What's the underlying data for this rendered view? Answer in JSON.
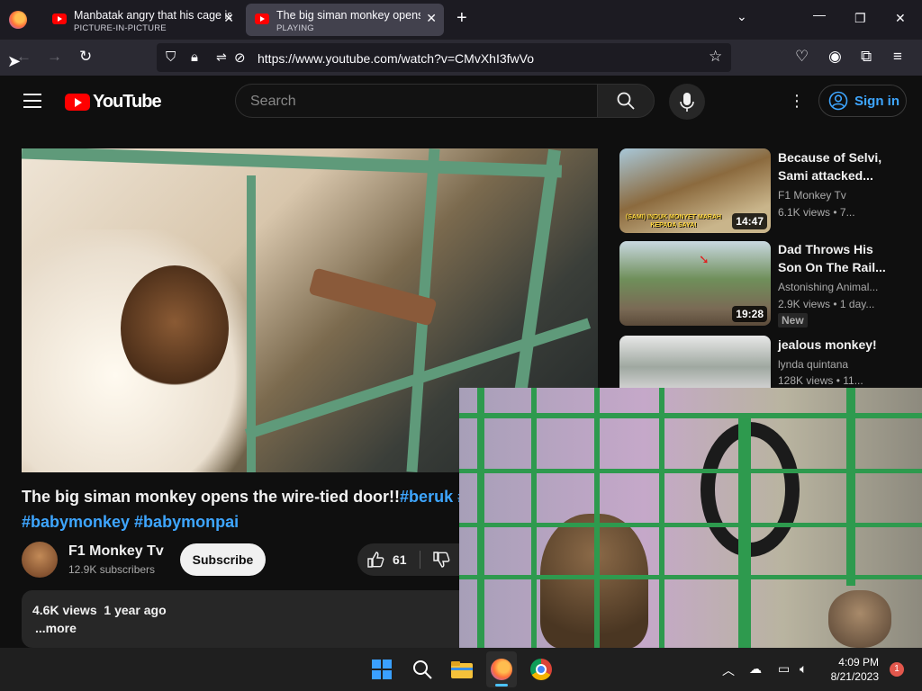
{
  "browser": {
    "tabs": [
      {
        "title": "Manbatak angry that his cage is",
        "status": "PICTURE-IN-PICTURE",
        "active": false
      },
      {
        "title": "The big siman monkey opens the",
        "status": "PLAYING",
        "active": true
      }
    ],
    "url": "https://www.youtube.com/watch?v=CMvXhI3fwVo",
    "new_tab_icon": "plus-icon"
  },
  "youtube": {
    "wordmark": "YouTube",
    "search_placeholder": "Search",
    "sign_in": "Sign in"
  },
  "video": {
    "title_line1": "The big siman monkey opens the wire-tied door!!",
    "title_tag": "#beruk #",
    "title_line2": "#babymonkey #babymonpai",
    "channel": "F1 Monkey Tv",
    "subscribers": "12.9K subscribers",
    "subscribe_label": "Subscribe",
    "likes": "61",
    "views": "4.6K views",
    "age": "1 year ago",
    "more": "...more"
  },
  "recommendations": [
    {
      "title": "Because of Selvi, Sami attacked...",
      "channel": "F1 Monkey Tv",
      "meta": "6.1K views  •  7...",
      "duration": "14:47",
      "badge": "",
      "thumb_caption": "(SAMI) INDUK MONYET MARAH KEPADA SAYA!"
    },
    {
      "title": "Dad Throws His Son On The Rail...",
      "channel": "Astonishing Animal...",
      "meta": "2.9K views  •  1 day...",
      "duration": "19:28",
      "badge": "New",
      "thumb_caption": ""
    },
    {
      "title": "jealous monkey!",
      "channel": "lynda quintana",
      "meta": "128K views  •  11...",
      "duration": "",
      "badge": "",
      "thumb_caption": ""
    }
  ],
  "taskbar": {
    "time": "4:09 PM",
    "date": "8/21/2023",
    "notifications": "1"
  },
  "colors": {
    "accent_link": "#3ea6ff",
    "yt_red": "#ff0000",
    "bg": "#0f0f0f"
  }
}
